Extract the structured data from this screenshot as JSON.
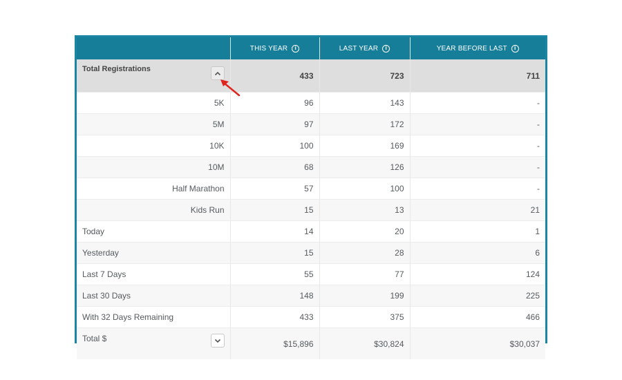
{
  "columns": {
    "this_year": "THIS YEAR",
    "last_year": "LAST YEAR",
    "year_before_last": "YEAR BEFORE LAST"
  },
  "total_registrations": {
    "label": "Total Registrations",
    "this_year": "433",
    "last_year": "723",
    "year_before_last": "711",
    "toggle_icon": "chevron-up-icon"
  },
  "rows": [
    {
      "label": "5K",
      "this_year": "96",
      "last_year": "143",
      "year_before_last": "-"
    },
    {
      "label": "5M",
      "this_year": "97",
      "last_year": "172",
      "year_before_last": "-"
    },
    {
      "label": "10K",
      "this_year": "100",
      "last_year": "169",
      "year_before_last": "-"
    },
    {
      "label": "10M",
      "this_year": "68",
      "last_year": "126",
      "year_before_last": "-"
    },
    {
      "label": "Half Marathon",
      "this_year": "57",
      "last_year": "100",
      "year_before_last": "-"
    },
    {
      "label": "Kids Run",
      "this_year": "15",
      "last_year": "13",
      "year_before_last": "21"
    },
    {
      "label": "Today",
      "this_year": "14",
      "last_year": "20",
      "year_before_last": "1"
    },
    {
      "label": "Yesterday",
      "this_year": "15",
      "last_year": "28",
      "year_before_last": "6"
    },
    {
      "label": "Last 7 Days",
      "this_year": "55",
      "last_year": "77",
      "year_before_last": "124"
    },
    {
      "label": "Last 30 Days",
      "this_year": "148",
      "last_year": "199",
      "year_before_last": "225"
    },
    {
      "label": "With 32 Days Remaining",
      "this_year": "433",
      "last_year": "375",
      "year_before_last": "466"
    }
  ],
  "total_money": {
    "label": "Total $",
    "this_year": "$15,896",
    "last_year": "$30,824",
    "year_before_last": "$30,037",
    "toggle_icon": "chevron-down-icon"
  },
  "colors": {
    "header": "#177e9a",
    "frame": "#1b86a3",
    "highlight_row": "#dedede",
    "annotation_arrow": "#e0231c"
  }
}
